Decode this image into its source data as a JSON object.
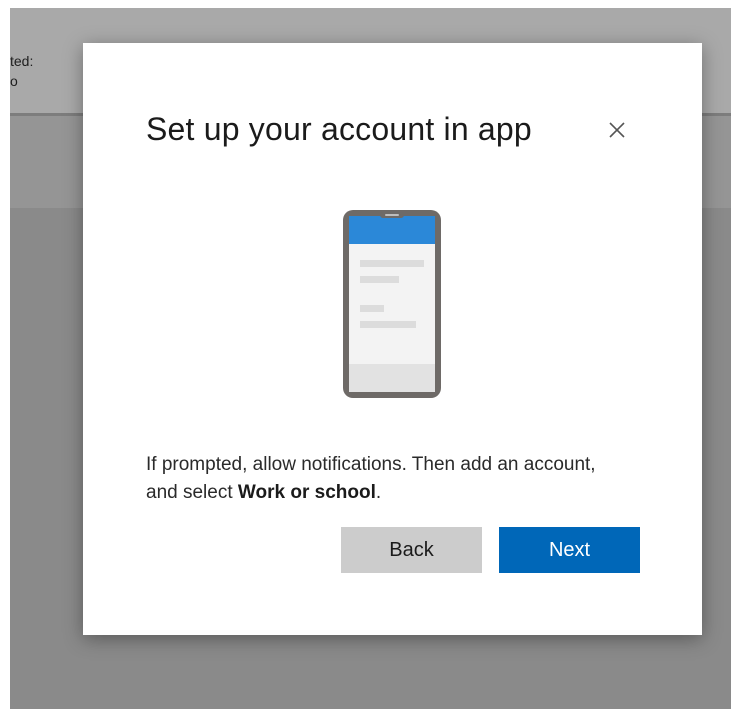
{
  "background": {
    "label_line1": "ted:",
    "label_line2": "o"
  },
  "dialog": {
    "title": "Set up your account in app",
    "close_icon": "close-icon",
    "illustration_icon": "phone-app-icon",
    "message_prefix": "If prompted, allow notifications. Then add an account, and select ",
    "message_bold": "Work or school",
    "message_suffix": ".",
    "back_label": "Back",
    "next_label": "Next"
  },
  "colors": {
    "primary_button": "#0067b8",
    "secondary_button": "#cccccc",
    "phone_screen_header": "#2b88d8",
    "overlay": "#8a8a8a"
  }
}
